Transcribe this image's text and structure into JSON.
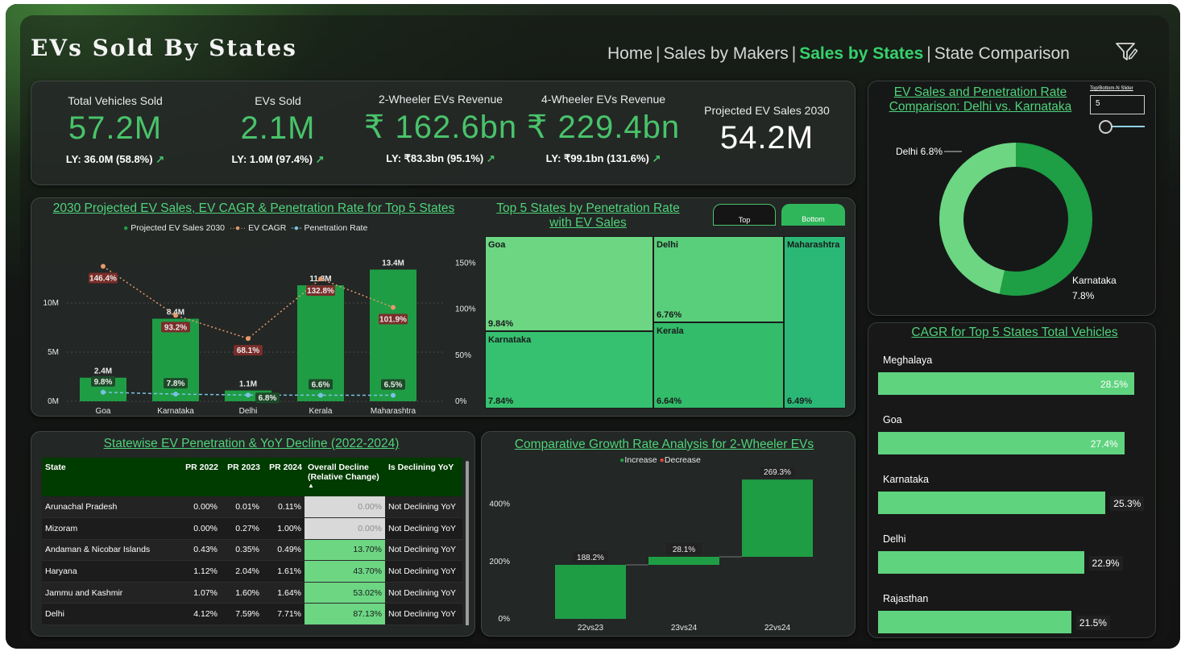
{
  "header": {
    "title": "EVs Sold By States",
    "nav": [
      "Home",
      "Sales by Makers",
      "Sales by States",
      "State Comparison"
    ],
    "nav_active": "Sales by States",
    "filter_icon": "filter-edit-icon"
  },
  "kpis": [
    {
      "label": "Total Vehicles Sold",
      "value": "57.2M",
      "ly": "LY: 36.0M (58.8%)",
      "arrow": "↗"
    },
    {
      "label": "EVs Sold",
      "value": "2.1M",
      "ly": "LY: 1.0M (97.4%)",
      "arrow": "↗"
    },
    {
      "label": "2-Wheeler EVs Revenue",
      "value": "₹ 162.6bn",
      "ly": "LY: ₹83.3bn (95.1%)",
      "arrow": "↗"
    },
    {
      "label": "4-Wheeler EVs Revenue",
      "value": "₹ 229.4bn",
      "ly": "LY: ₹99.1bn (131.6%)",
      "arrow": "↗"
    },
    {
      "label": "Projected EV Sales 2030",
      "value": "54.2M"
    }
  ],
  "combo": {
    "title": "2030 Projected EV Sales, EV CAGR & Penetration Rate for Top 5 States",
    "legend": [
      "Projected EV Sales 2030",
      "EV CAGR",
      "Penetration Rate"
    ],
    "left_ticks": [
      "0M",
      "5M",
      "10M"
    ],
    "right_ticks": [
      "0%",
      "50%",
      "100%",
      "150%"
    ],
    "colors": {
      "bar": "#1f9d45",
      "cagr": "#e59a6c",
      "pen": "#7cc2e3"
    }
  },
  "treemap": {
    "title_line1": "Top 5 States by Penetration Rate",
    "title_line2": "with EV Sales",
    "toggle": [
      "Top",
      "Bottom"
    ],
    "cells": [
      {
        "name": "Goa",
        "value": "9.84%"
      },
      {
        "name": "Karnataka",
        "value": "7.84%"
      },
      {
        "name": "Delhi",
        "value": "6.76%"
      },
      {
        "name": "Kerala",
        "value": "6.64%"
      },
      {
        "name": "Maharashtra",
        "value": "6.49%"
      }
    ]
  },
  "donut": {
    "title_line1": "EV Sales and Penetration Rate",
    "title_line2": "Comparison: Delhi vs. Karnataka",
    "slider_label": "Top/Bottom-N Slider",
    "slider_value": "5",
    "delhi_label": "Delhi 6.8%",
    "karnataka_label": "Karnataka",
    "karnataka_value": "7.8%"
  },
  "cagr": {
    "title": "CAGR for Top 5 States Total Vehicles",
    "items": [
      {
        "state": "Meghalaya",
        "value": "28.5%",
        "pct": 28.5
      },
      {
        "state": "Goa",
        "value": "27.4%",
        "pct": 27.4
      },
      {
        "state": "Karnataka",
        "value": "25.3%",
        "pct": 25.3
      },
      {
        "state": "Delhi",
        "value": "22.9%",
        "pct": 22.9
      },
      {
        "state": "Rajasthan",
        "value": "21.5%",
        "pct": 21.5
      }
    ]
  },
  "table": {
    "title": "Statewise EV Penetration & YoY Decline (2022-2024)",
    "headers": [
      "State",
      "PR 2022",
      "PR 2023",
      "PR 2024",
      "Overall Decline (Relative Change)",
      "Is Declining YoY"
    ],
    "sort_indicator": "▲",
    "rows": [
      [
        "Arunachal Pradesh",
        "0.00%",
        "0.01%",
        "0.11%",
        "0.00%",
        "Not Declining YoY"
      ],
      [
        "Mizoram",
        "0.00%",
        "0.27%",
        "1.00%",
        "0.00%",
        "Not Declining YoY"
      ],
      [
        "Andaman & Nicobar Islands",
        "0.43%",
        "0.35%",
        "0.49%",
        "13.70%",
        "Not Declining YoY"
      ],
      [
        "Haryana",
        "1.12%",
        "2.04%",
        "1.61%",
        "43.70%",
        "Not Declining YoY"
      ],
      [
        "Jammu and Kashmir",
        "1.07%",
        "1.60%",
        "1.64%",
        "53.02%",
        "Not Declining YoY"
      ],
      [
        "Delhi",
        "4.12%",
        "7.59%",
        "7.71%",
        "87.13%",
        "Not Declining YoY"
      ]
    ]
  },
  "waterfall": {
    "title": "Comparative Growth Rate Analysis for 2-Wheeler EVs",
    "legend": [
      "Increase",
      "Decrease"
    ],
    "y_ticks": [
      "0%",
      "200%",
      "400%"
    ]
  },
  "chart_data": [
    {
      "type": "bar",
      "title": "2030 Projected EV Sales, EV CAGR & Penetration Rate for Top 5 States",
      "categories": [
        "Goa",
        "Karnataka",
        "Delhi",
        "Kerala",
        "Maharashtra"
      ],
      "series": [
        {
          "name": "Projected EV Sales 2030",
          "values": [
            2.4,
            8.4,
            1.1,
            11.8,
            13.4
          ],
          "labels": [
            "2.4M",
            "8.4M",
            "1.1M",
            "11.8M",
            "13.4M"
          ],
          "axis": "left"
        },
        {
          "name": "EV CAGR",
          "values": [
            146.4,
            93.2,
            68.1,
            132.8,
            101.9
          ],
          "labels": [
            "146.4%",
            "93.2%",
            "68.1%",
            "132.8%",
            "101.9%"
          ],
          "axis": "right"
        },
        {
          "name": "Penetration Rate",
          "values": [
            9.8,
            7.8,
            6.8,
            6.6,
            6.5
          ],
          "labels": [
            "9.8%",
            "7.8%",
            "6.8%",
            "6.6%",
            "6.5%"
          ],
          "axis": "right"
        }
      ],
      "ylim_left": [
        0,
        15
      ],
      "ylim_right": [
        0,
        160
      ]
    },
    {
      "type": "bar",
      "title": "Comparative Growth Rate Analysis for 2-Wheeler EVs",
      "categories": [
        "22vs23",
        "23vs24",
        "22vs24"
      ],
      "values": [
        188.2,
        28.1,
        269.3
      ],
      "labels": [
        "188.2%",
        "28.1%",
        "269.3%"
      ],
      "ylim": [
        0,
        500
      ]
    }
  ]
}
